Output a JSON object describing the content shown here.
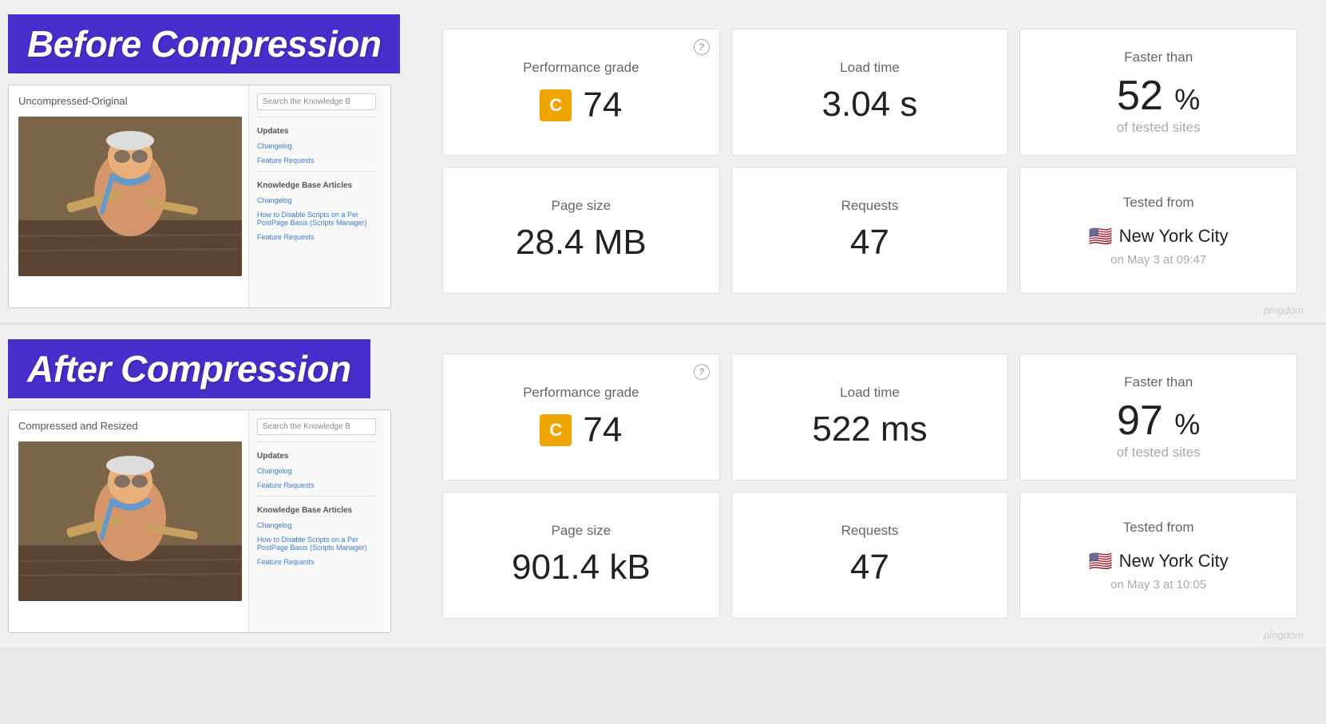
{
  "sections": [
    {
      "id": "before",
      "title": "Before Compression",
      "mockup": {
        "label": "Uncompressed-Original",
        "search_placeholder": "Search the Knowledge B",
        "section_updates": "Updates",
        "link1": "Changelog",
        "link2": "Feature Requests",
        "section_kb": "Knowledge Base Articles",
        "kb_link1": "Changelog",
        "kb_link2": "How to Disable Scripts on a Per PostPage Basis (Scripts Manager)",
        "kb_link3": "Feature Requests"
      },
      "metrics": [
        {
          "id": "performance-grade",
          "label": "Performance grade",
          "grade": "C",
          "value": "74",
          "has_help": true
        },
        {
          "id": "load-time",
          "label": "Load time",
          "value": "3.04 s"
        },
        {
          "id": "faster-than",
          "label": "Faster than",
          "percent": "52",
          "sub": "of tested sites"
        },
        {
          "id": "page-size",
          "label": "Page size",
          "value": "28.4 MB"
        },
        {
          "id": "requests",
          "label": "Requests",
          "value": "47"
        },
        {
          "id": "tested-from",
          "label": "Tested from",
          "city": "New York City",
          "date": "on May 3 at 09:47"
        }
      ],
      "pingdom": "pingdom"
    },
    {
      "id": "after",
      "title": "After Compression",
      "mockup": {
        "label": "Compressed and Resized",
        "search_placeholder": "Search the Knowledge B",
        "section_updates": "Updates",
        "link1": "Changelog",
        "link2": "Feature Requests",
        "section_kb": "Knowledge Base Articles",
        "kb_link1": "Changelog",
        "kb_link2": "How to Disable Scripts on a Per PostPage Basis (Scripts Manager)",
        "kb_link3": "Feature Requests"
      },
      "metrics": [
        {
          "id": "performance-grade",
          "label": "Performance grade",
          "grade": "C",
          "value": "74",
          "has_help": true
        },
        {
          "id": "load-time",
          "label": "Load time",
          "value": "522 ms"
        },
        {
          "id": "faster-than",
          "label": "Faster than",
          "percent": "97",
          "sub": "of tested sites"
        },
        {
          "id": "page-size",
          "label": "Page size",
          "value": "901.4 kB"
        },
        {
          "id": "requests",
          "label": "Requests",
          "value": "47"
        },
        {
          "id": "tested-from",
          "label": "Tested from",
          "city": "New York City",
          "date": "on May 3 at 10:05"
        }
      ],
      "pingdom": "pingdom"
    }
  ],
  "ui": {
    "help_icon": "?",
    "flag": "🇺🇸"
  }
}
